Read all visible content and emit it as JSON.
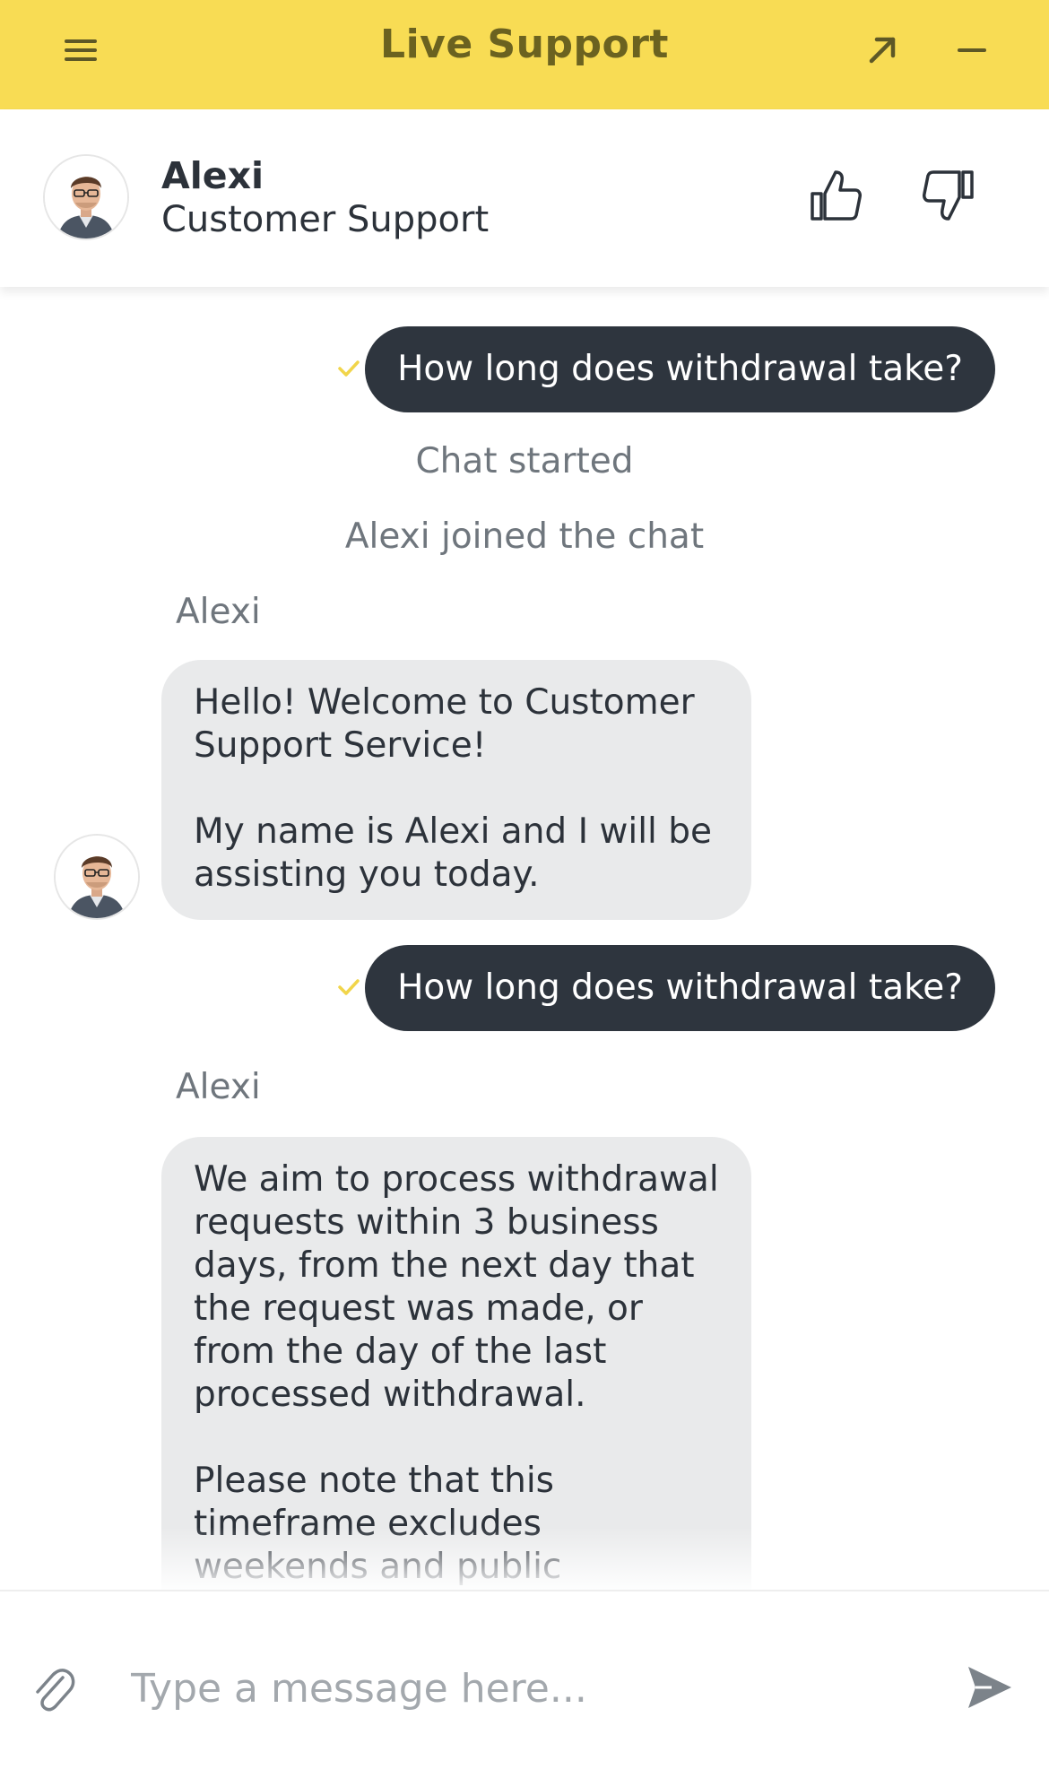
{
  "header": {
    "title": "Live Support",
    "accent_color": "#f8dc54",
    "icons": [
      "hamburger-menu-icon",
      "expand-arrow-icon",
      "minimize-icon"
    ]
  },
  "agent": {
    "name": "Alexi",
    "role": "Customer Support",
    "avatar_icon": "agent-avatar",
    "rating_icons": [
      "thumbs-up-icon",
      "thumbs-down-icon"
    ]
  },
  "messages": {
    "m1": {
      "from": "user",
      "text": "How long does withdrawal take?",
      "status_icon": "check-icon"
    },
    "s1": {
      "text": "Chat started"
    },
    "s2": {
      "text": "Alexi joined the chat"
    },
    "m2": {
      "from": "agent",
      "sender": "Alexi",
      "p1": "Hello! Welcome to Customer Support Service!",
      "p2": "My name is Alexi and I will be assisting you today."
    },
    "m3": {
      "from": "user",
      "text": "How long does withdrawal take?",
      "status_icon": "check-icon"
    },
    "m4": {
      "from": "agent",
      "sender": "Alexi",
      "p1": "We aim to process withdrawal requests within 3 business days, from the next day that the request was made, or from the day of the last processed withdrawal.",
      "p2": "Please note that this timeframe excludes weekends and public holidays. The"
    }
  },
  "composer": {
    "placeholder": "Type a message here...",
    "value": "",
    "icons": [
      "paperclip-icon",
      "send-icon"
    ]
  },
  "colors": {
    "user_bubble": "#2e353e",
    "agent_bubble": "#e9eaeb",
    "check": "#f1d54a",
    "muted_text": "#6f767d"
  }
}
